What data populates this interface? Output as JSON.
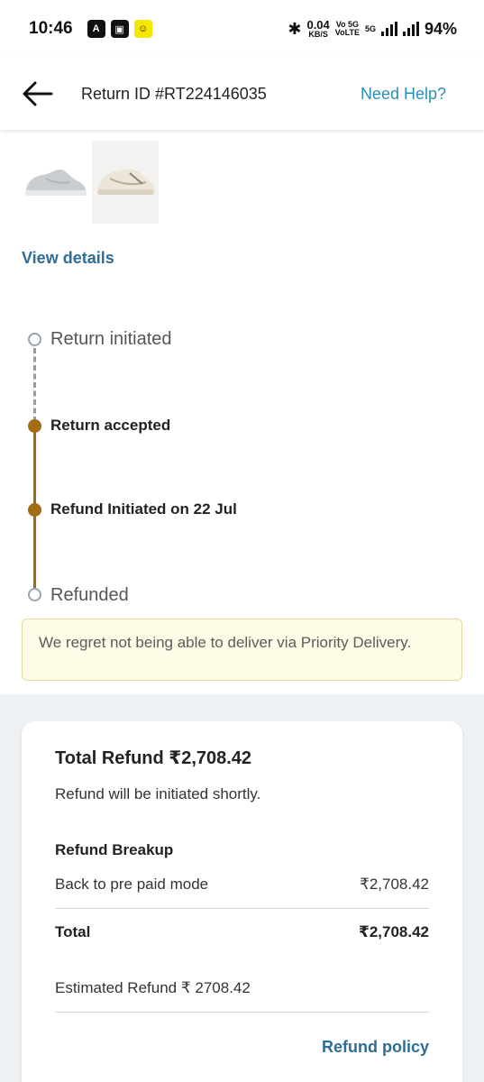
{
  "status_bar": {
    "time": "10:46",
    "net_speed_value": "0.04",
    "net_speed_unit": "KB/S",
    "volte_top": "Vo 5G",
    "volte_bottom": "VoLTE",
    "network": "5G",
    "battery": "94%"
  },
  "header": {
    "title": "Return ID #RT224146035",
    "help_label": "Need Help?"
  },
  "product": {
    "view_details_label": "View details"
  },
  "timeline": [
    {
      "label": "Return initiated",
      "state": "pending"
    },
    {
      "label": "Return accepted",
      "state": "done"
    },
    {
      "label": "Refund Initiated on 22 Jul",
      "state": "done"
    },
    {
      "label": "Refunded",
      "state": "pending"
    }
  ],
  "notice": {
    "text": "We regret not being able to deliver via Priority Delivery."
  },
  "refund": {
    "total_label": "Total Refund ₹2,708.42",
    "subtitle": "Refund will be initiated shortly.",
    "breakup_title": "Refund Breakup",
    "rows": [
      {
        "label": "Back to pre paid mode",
        "value": "₹2,708.42"
      }
    ],
    "total_row": {
      "label": "Total",
      "value": "₹2,708.42"
    },
    "estimated": "Estimated Refund ₹ 2708.42",
    "policy_label": "Refund policy"
  },
  "colors": {
    "accent_link": "#2e6e96",
    "help_link": "#2a8fb8",
    "timeline_done": "#a36c12",
    "notice_bg": "#fefbe7"
  }
}
